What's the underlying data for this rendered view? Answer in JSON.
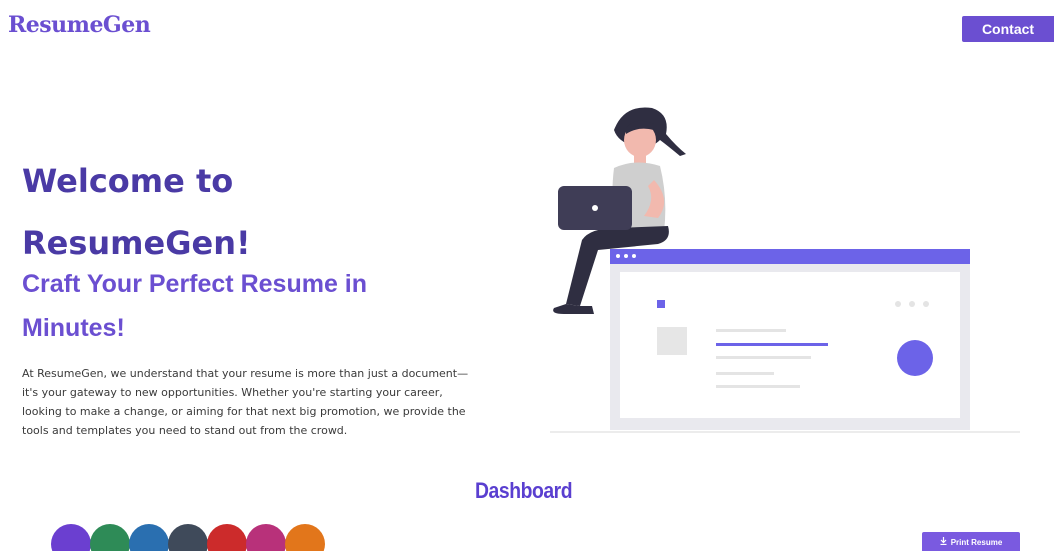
{
  "header": {
    "logo": "ResumeGen",
    "contact_label": "Contact"
  },
  "hero": {
    "title": "Welcome to ResumeGen!",
    "subtitle": "Craft Your Perfect Resume in Minutes!",
    "body": "At ResumeGen, we understand that your resume is more than just a document—it's your gateway to new opportunities. Whether you're starting your career, looking to make a change, or aiming for that next big promotion, we provide the tools and templates you need to stand out from the crowd."
  },
  "dashboard": {
    "title": "Dashboard",
    "swatch_colors": [
      "#6b3fd0",
      "#2e8b57",
      "#2a6fb0",
      "#3f4a5a",
      "#cc2b2b",
      "#b8317a",
      "#e2761b"
    ],
    "print_label": "Print Resume"
  },
  "colors": {
    "brand": "#6b4fd1",
    "heading": "#4a3aa5"
  },
  "icons": {
    "print": "download-icon"
  }
}
